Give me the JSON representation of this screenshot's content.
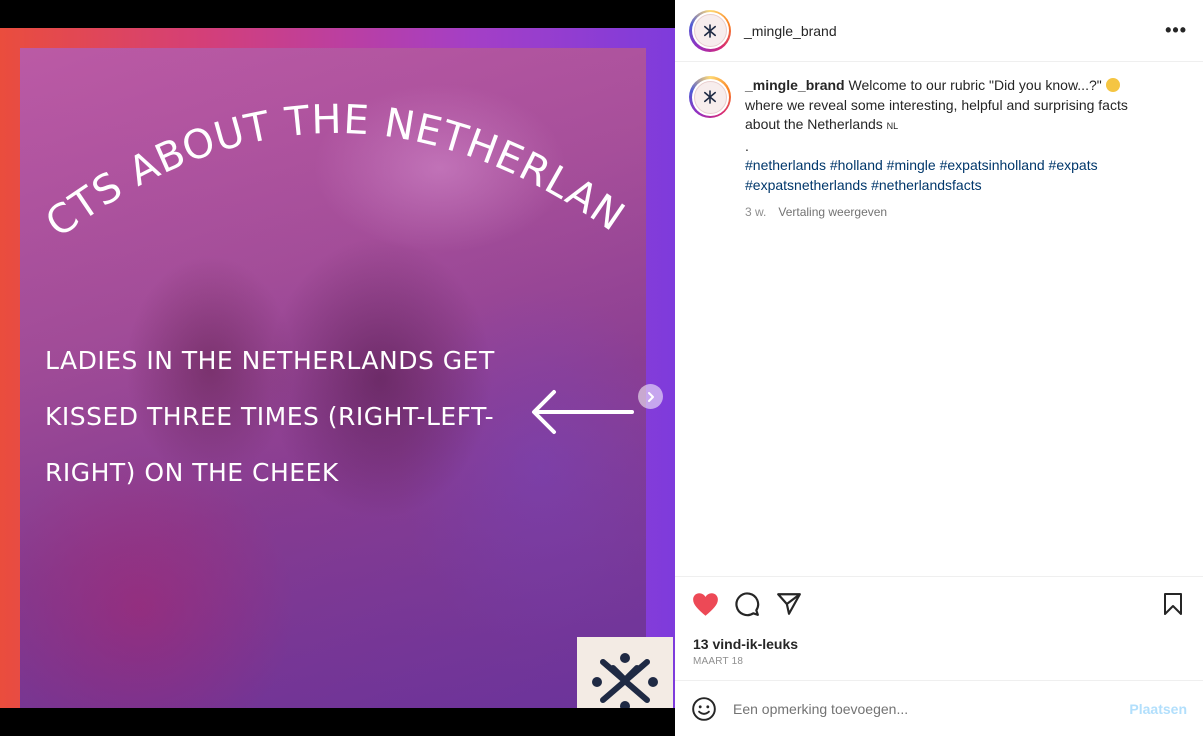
{
  "media": {
    "arc_title": "FACTS ABOUT THE NETHERLANDS",
    "fact_lines": [
      "LADIES IN THE NETHERLANDS GET",
      "KISSED THREE TIMES (RIGHT-LEFT-",
      "RIGHT) ON THE CHEEK"
    ],
    "carousel": {
      "total_slides": 6,
      "active_index": 0
    },
    "gradient_colors": [
      "#ea4d3d",
      "#d43f78",
      "#a43fc6",
      "#7e3bdc"
    ],
    "logo_color": "#1f2a44",
    "icons": {
      "next": "chevron-right-icon",
      "arrow": "left-arrow-icon",
      "logo": "mingle-logo-icon"
    }
  },
  "post": {
    "username": "_mingle_brand",
    "more_icon": "•••",
    "caption": {
      "text": "Welcome to our rubric \"Did you know...?\"",
      "text2": " where we reveal some interesting, helpful and surprising facts about the Netherlands",
      "country_code": "NL",
      "dot": ".",
      "hashtags": "#netherlands #holland #mingle #expatsinholland #expats #expatsnetherlands #netherlandsfacts"
    },
    "meta": {
      "age": "3 w.",
      "translate": "Vertaling weergeven"
    },
    "likes": "13 vind-ik-leuks",
    "date": "MAART 18",
    "liked": true,
    "like_color": "#ed4956"
  },
  "comment": {
    "placeholder": "Een opmerking toevoegen...",
    "post_label": "Plaatsen"
  }
}
